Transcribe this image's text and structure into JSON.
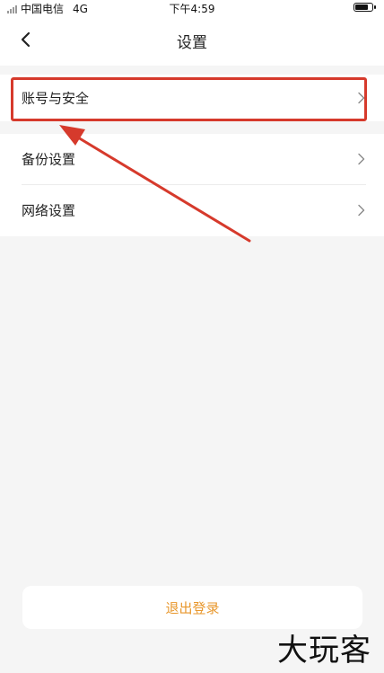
{
  "status_bar": {
    "carrier": "中国电信",
    "network": "4G",
    "time": "下午4:59",
    "battery_level": 0.85
  },
  "nav": {
    "title": "设置"
  },
  "settings": {
    "items": [
      {
        "label": "账号与安全",
        "icon": "chevron-right-icon"
      },
      {
        "label": "备份设置",
        "icon": "chevron-right-icon"
      },
      {
        "label": "网络设置",
        "icon": "chevron-right-icon"
      }
    ]
  },
  "logout": {
    "label": "退出登录"
  },
  "colors": {
    "highlight": "#d63a2c",
    "logout_text": "#e8972c",
    "background": "#f5f5f5"
  },
  "watermark": {
    "text": "大玩客"
  }
}
